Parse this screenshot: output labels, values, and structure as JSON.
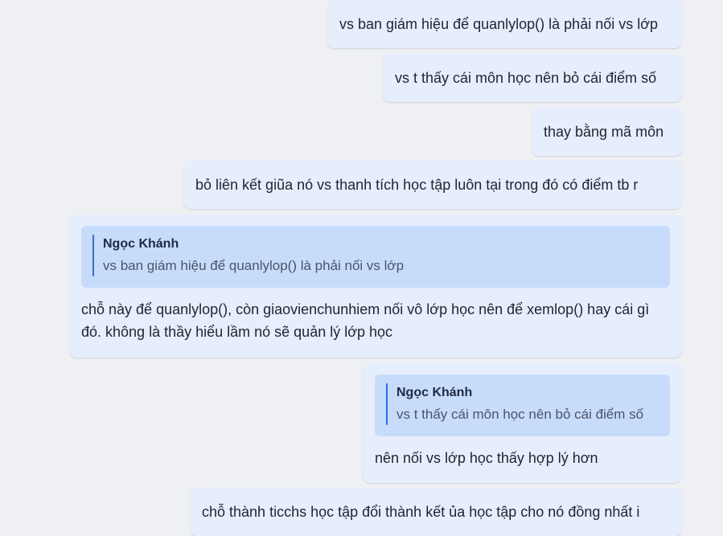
{
  "messages": [
    {
      "text": "vs ban giám hiệu để quanlylop() là phải nối vs lớp"
    },
    {
      "text": "vs t thấy cái môn học nên bỏ cái điểm số"
    },
    {
      "text": "thay bằng mã môn"
    },
    {
      "text": "bỏ liên kết giũa nó vs thanh tích học tập luôn tại trong đó có điểm tb r"
    },
    {
      "quote": {
        "author": "Ngọc Khánh",
        "text": "vs ban giám hiệu để quanlylop() là phải nối vs lớp"
      },
      "text": "chỗ này để quanlylop(), còn giaovienchunhiem nối vô lớp học nên để xemlop() hay cái gì đó. không là thầy hiểu lầm nó sẽ quản lý lớp học"
    },
    {
      "quote": {
        "author": "Ngọc Khánh",
        "text": "vs t thấy cái môn học nên bỏ cái điểm số"
      },
      "text": "nên nối vs lớp học thấy hợp lý hơn"
    },
    {
      "text": "chỗ thành ticchs học tập đổi thành kết ủa học tập cho nó đồng nhất i"
    }
  ]
}
